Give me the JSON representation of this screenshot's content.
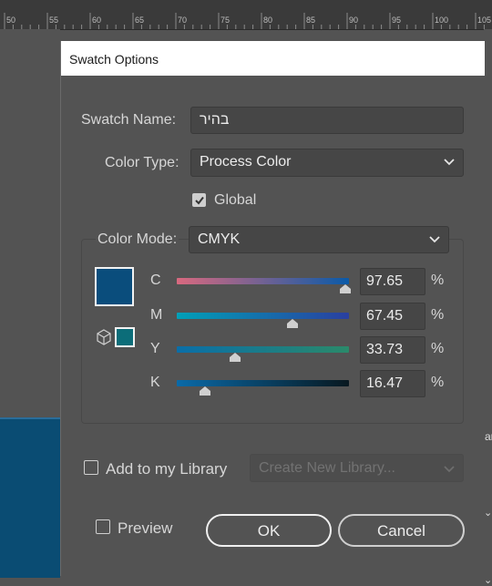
{
  "ruler": {
    "labels": [
      "50",
      "55",
      "60",
      "65",
      "70",
      "75",
      "80",
      "85",
      "90",
      "95",
      "100",
      "105"
    ]
  },
  "dialog": {
    "title": "Swatch Options",
    "swatch_name_label": "Swatch Name:",
    "swatch_name_value": "בהיר",
    "color_type_label": "Color Type:",
    "color_type_value": "Process Color",
    "global_label": "Global",
    "global_checked": true,
    "color_mode_label": "Color Mode:",
    "color_mode_value": "CMYK",
    "channels": [
      {
        "label": "C",
        "value": "97.65",
        "unit": "%",
        "fraction": 0.9765,
        "track_gradient": [
          "#d9697f",
          "#0a5aa8"
        ]
      },
      {
        "label": "M",
        "value": "67.45",
        "unit": "%",
        "fraction": 0.6745,
        "track_gradient": [
          "#00a0b8",
          "#2a3fa0"
        ]
      },
      {
        "label": "Y",
        "value": "33.73",
        "unit": "%",
        "fraction": 0.3373,
        "track_gradient": [
          "#0a6ea8",
          "#2a8a6a"
        ]
      },
      {
        "label": "K",
        "value": "16.47",
        "unit": "%",
        "fraction": 0.1647,
        "track_gradient": [
          "#0a6aa8",
          "#081820"
        ]
      }
    ],
    "swatch_color": "#0a4d7c",
    "out_of_gamut_swatch_color": "#0c6d79",
    "add_to_library_label": "Add to my Library",
    "add_to_library_checked": false,
    "library_select_placeholder": "Create New Library...",
    "preview_label": "Preview",
    "preview_checked": false,
    "ok_label": "OK",
    "cancel_label": "Cancel"
  },
  "background": {
    "document_color": "#0a4c73",
    "right_fragment": "ar"
  }
}
